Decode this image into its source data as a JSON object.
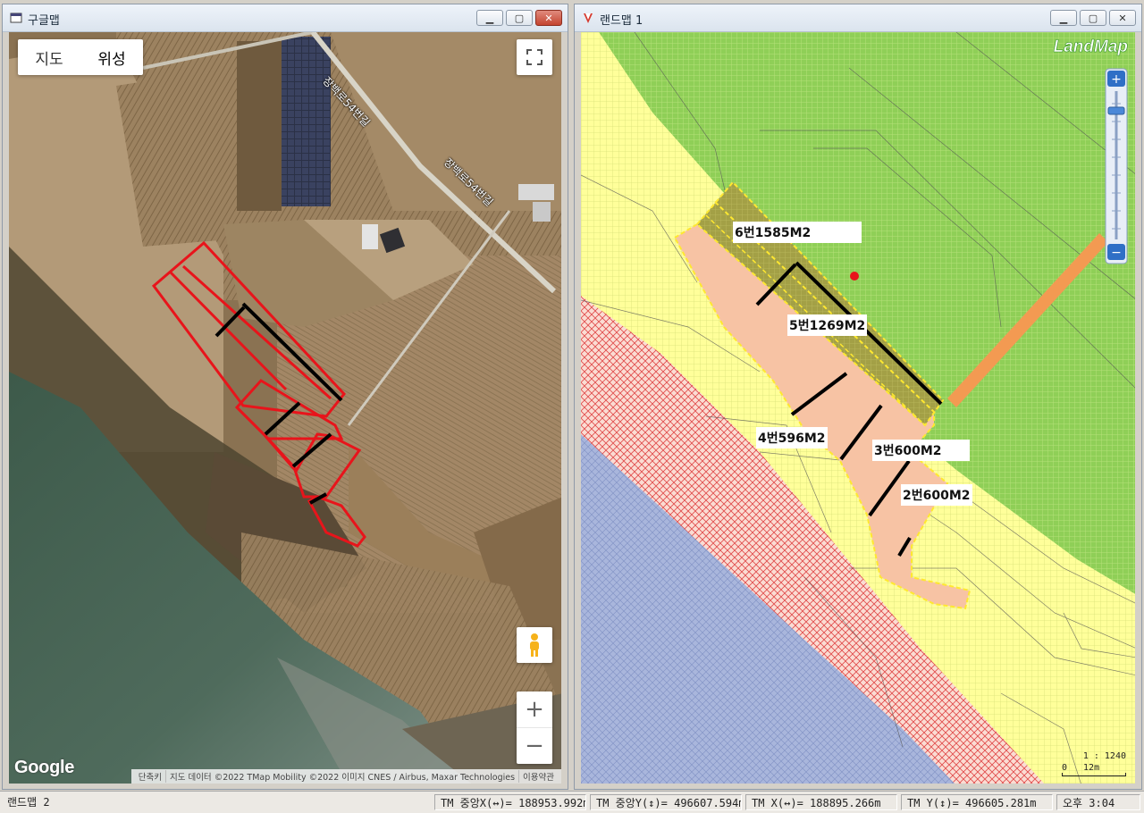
{
  "google_window": {
    "title": "구글맵",
    "map_type": {
      "map": "지도",
      "satellite": "위성"
    },
    "road_labels": [
      "장백로54번길",
      "장백로54번길"
    ],
    "logo": "Google",
    "attribution": {
      "shortcuts": "단축키",
      "data": "지도 데이터 ©2022 TMap Mobility ©2022 이미지 CNES / Airbus, Maxar Technologies",
      "terms": "이용약관"
    },
    "controls": {
      "zoom_in": "+",
      "zoom_out": "−"
    }
  },
  "landmap_window": {
    "title": "랜드맵 1",
    "logo": "LandMap",
    "parcel_labels": [
      "6번1585M2",
      "5번1269M2",
      "4번596M2",
      "3번600M2",
      "2번600M2"
    ],
    "scale": {
      "ratio": "1 : 1240",
      "zero": "0",
      "distance": "12m"
    },
    "zoom": {
      "in": "+",
      "out": "−"
    }
  },
  "status_bar": {
    "app_name": "랜드맵 2",
    "tm_center_x": "TM 중앙X(↔)= 188953.992m",
    "tm_center_y": "TM 중앙Y(↕)= 496607.594m",
    "tm_x": "TM X(↔)= 188895.266m",
    "tm_y": "TM Y(↕)= 496605.281m",
    "clock": "오후 3:04"
  },
  "colors": {
    "parcel_outline_google": "#e8141b",
    "cut_line": "#000000",
    "zone_green": "#8fcf57",
    "zone_yellow": "#ffff9a",
    "zone_salmon": "#f7c3a4",
    "zone_red_hatch": "#e04848",
    "zone_blue": "#9fb0d8",
    "road_orange": "#f39a52",
    "olive_highlight": "#9a9a3c"
  }
}
